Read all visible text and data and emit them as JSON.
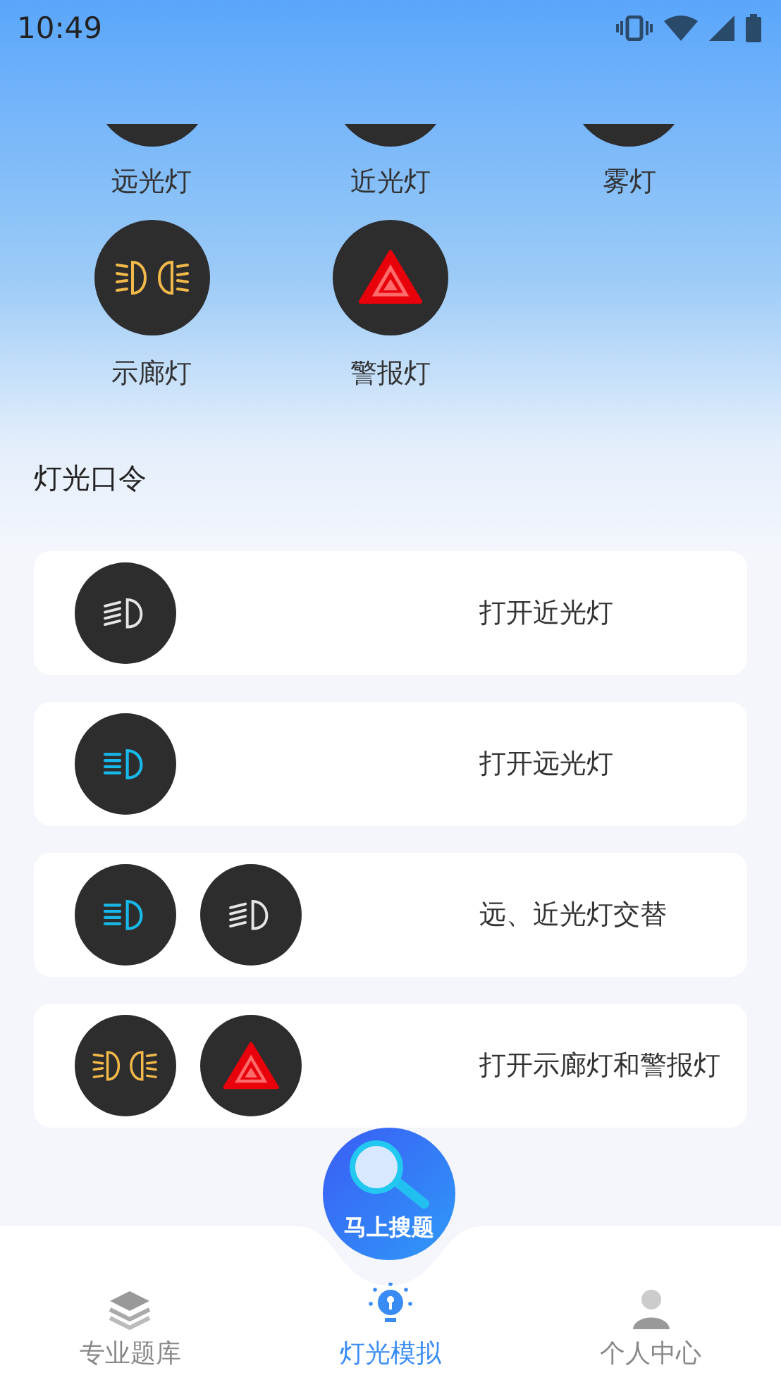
{
  "status_bar": {
    "time": "10:49"
  },
  "lamps": [
    {
      "label": "远光灯",
      "cut": true
    },
    {
      "label": "近光灯",
      "cut": true
    },
    {
      "label": "雾灯",
      "cut": true
    },
    {
      "label": "示廊灯",
      "kind": "position",
      "cut": false
    },
    {
      "label": "警报灯",
      "kind": "hazard",
      "cut": false
    }
  ],
  "section_title": "灯光口令",
  "commands": [
    {
      "icons": [
        {
          "kind": "low"
        }
      ],
      "text": "打开近光灯"
    },
    {
      "icons": [
        {
          "kind": "high"
        }
      ],
      "text": "打开远光灯"
    },
    {
      "icons": [
        {
          "kind": "high"
        },
        {
          "kind": "low"
        }
      ],
      "text": "远、近光灯交替"
    },
    {
      "icons": [
        {
          "kind": "position"
        },
        {
          "kind": "hazard"
        }
      ],
      "text": "打开示廊灯和警报灯"
    }
  ],
  "search_button": {
    "label": "马上搜题"
  },
  "tabs": [
    {
      "label": "专业题库",
      "kind": "layers",
      "selected": false
    },
    {
      "label": "灯光模拟",
      "kind": "bulb",
      "selected": true
    },
    {
      "label": "个人中心",
      "kind": "person",
      "selected": false
    }
  ]
}
